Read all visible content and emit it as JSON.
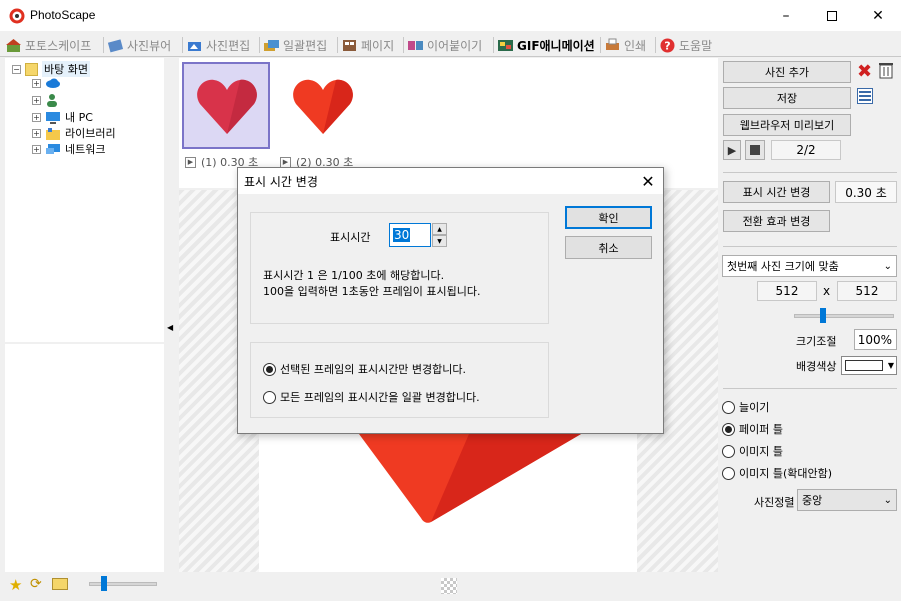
{
  "window": {
    "title": "PhotoScape",
    "controls": [
      "minimize-icon",
      "maximize-icon",
      "close-icon"
    ]
  },
  "tabs": [
    {
      "label": "포토스케이프",
      "icon": "photoscape-home-icon",
      "active": false
    },
    {
      "label": "사진뷰어",
      "icon": "viewer-icon",
      "active": false
    },
    {
      "label": "사진편집",
      "icon": "editor-icon",
      "active": false
    },
    {
      "label": "일괄편집",
      "icon": "batch-icon",
      "active": false
    },
    {
      "label": "페이지",
      "icon": "page-icon",
      "active": false
    },
    {
      "label": "이어붙이기",
      "icon": "combine-icon",
      "active": false
    },
    {
      "label": "GIF애니메이션",
      "icon": "gif-icon",
      "active": true
    },
    {
      "label": "인쇄",
      "icon": "print-icon",
      "active": false
    },
    {
      "label": "도움말",
      "icon": "help-icon",
      "active": false
    }
  ],
  "tree": {
    "items": [
      {
        "label": "바탕 화면",
        "icon": "desktop-folder-icon"
      },
      {
        "label": "",
        "icon": "onedrive-icon"
      },
      {
        "label": "",
        "icon": "user-icon"
      },
      {
        "label": "내 PC",
        "icon": "pc-icon"
      },
      {
        "label": "라이브러리",
        "icon": "library-icon"
      },
      {
        "label": "네트워크",
        "icon": "network-icon"
      }
    ]
  },
  "frames": [
    {
      "label": "(1) 0.30 초",
      "color": "#d8334a"
    },
    {
      "label": "(2) 0.30 초",
      "color": "#e8281e"
    }
  ],
  "right_panel": {
    "add_photo": "사진 추가",
    "save": "저장",
    "browser_preview": "웹브라우저 미리보기",
    "frame_counter": "2/2",
    "change_time_button": "표시 시간 변경",
    "time_value": "0.30 초",
    "change_effect_button": "전환 효과 변경",
    "size_mode": "첫번째 사진 크기에 맞춤",
    "width": "512",
    "times": "x",
    "height": "512",
    "zoom_label": "크기조절",
    "zoom_value": "100%",
    "bgcolor_label": "배경색상",
    "fit_options": [
      {
        "label": "늘이기",
        "checked": false
      },
      {
        "label": "페이퍼 틀",
        "checked": true
      },
      {
        "label": "이미지 틀",
        "checked": false
      },
      {
        "label": "이미지 틀(확대안함)",
        "checked": false
      }
    ],
    "align_label": "사진정렬",
    "align_value": "중앙"
  },
  "dialog": {
    "title": "표시 시간 변경",
    "time_label": "표시시간",
    "time_value": "30",
    "help_line1": "표시시간 1 은 1/100 초에 해당합니다.",
    "help_line2": "100을 입력하면 1초동안 프레임이 표시됩니다.",
    "ok": "확인",
    "cancel": "취소",
    "options": [
      {
        "label": "선택된 프레임의 표시시간만 변경합니다.",
        "checked": true
      },
      {
        "label": "모든 프레임의 표시시간을 일괄 변경합니다.",
        "checked": false
      }
    ]
  },
  "colors": {
    "heart1": "#d8334a",
    "heart2": "#e8281e",
    "selection": "#dcd8f4",
    "selection_border": "#7b74c8",
    "accent": "#0078d7"
  }
}
